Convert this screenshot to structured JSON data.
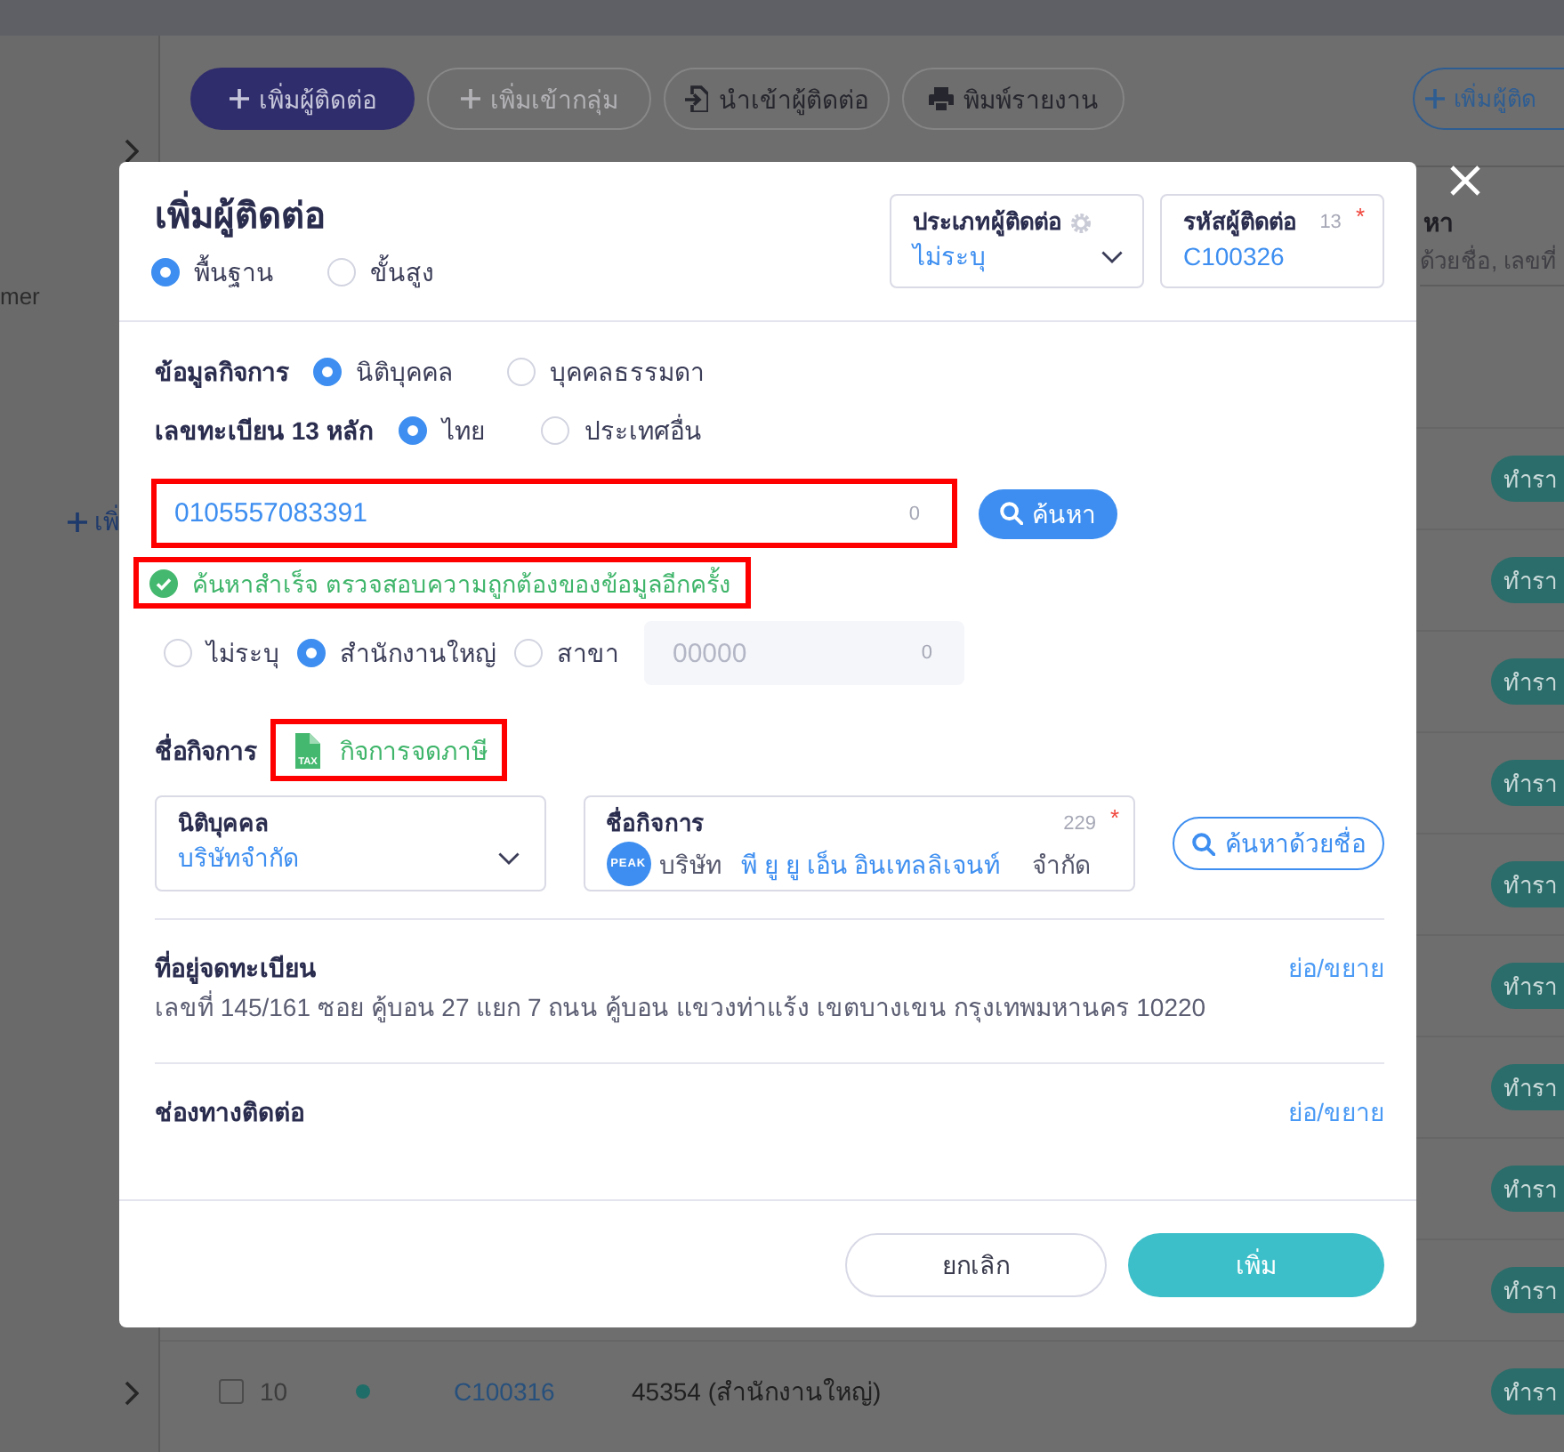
{
  "background": {
    "sidebar": {
      "item_text": "mer",
      "add_link": "เพิ่"
    },
    "toolbar": {
      "buttons": [
        {
          "label": "เพิ่มผู้ติดต่อ",
          "kind": "primary",
          "disabled": false
        },
        {
          "label": "เพิ่มเข้ากลุ่ม",
          "kind": "add",
          "disabled": true
        },
        {
          "label": "นำเข้าผู้ติดต่อ",
          "kind": "import",
          "disabled": false
        },
        {
          "label": "พิมพ์รายงาน",
          "kind": "print",
          "disabled": false
        }
      ],
      "right_button": "เพิ่มผู้ติด"
    },
    "search": {
      "label": "หา",
      "placeholder": "ด้วยชื่อ, เลขที่"
    },
    "table": {
      "rows": [
        {
          "action": "ทำรา"
        },
        {
          "action": "ทำรา"
        },
        {
          "action": "ทำรา"
        },
        {
          "action": "ทำรา"
        },
        {
          "action": "ทำรา"
        },
        {
          "action": "ทำรา"
        },
        {
          "action": "ทำรา"
        },
        {
          "action": "ทำรา"
        },
        {
          "action": "ทำรา"
        },
        {
          "checked": false,
          "number": "10",
          "code": "C100316",
          "name": "45354 (สำนักงานใหญ่)",
          "action": "ทำรา"
        }
      ]
    }
  },
  "modal": {
    "title": "เพิ่มผู้ติดต่อ",
    "modes": [
      {
        "label": "พื้นฐาน",
        "selected": true
      },
      {
        "label": "ขั้นสูง",
        "selected": false
      }
    ],
    "contact_type": {
      "label": "ประเภทผู้ติดต่อ",
      "value": "ไม่ระบุ"
    },
    "contact_code": {
      "label": "รหัสผู้ติดต่อ",
      "counter": "13",
      "required_mark": "*",
      "value": "C100326"
    },
    "business_info": {
      "label": "ข้อมูลกิจการ",
      "options": [
        {
          "label": "นิติบุคคล",
          "selected": true
        },
        {
          "label": "บุคคลธรรมดา",
          "selected": false
        }
      ]
    },
    "registration": {
      "label": "เลขทะเบียน 13 หลัก",
      "options": [
        {
          "label": "ไทย",
          "selected": true
        },
        {
          "label": "ประเทศอื่น",
          "selected": false
        }
      ],
      "value": "0105557083391",
      "counter": "0",
      "highlighted": true,
      "search_button": "ค้นหา"
    },
    "success_message": {
      "text": "ค้นหาสำเร็จ ตรวจสอบความถูกต้องของข้อมูลอีกครั้ง",
      "highlighted": true
    },
    "branch": {
      "options": [
        {
          "label": "ไม่ระบุ",
          "selected": false
        },
        {
          "label": "สำนักงานใหญ่",
          "selected": true
        },
        {
          "label": "สาขา",
          "selected": false
        }
      ],
      "placeholder": "00000",
      "counter": "0",
      "disabled": true
    },
    "business_name": {
      "label": "ชื่อกิจการ",
      "tax_badge": {
        "icon_text": "TAX",
        "text": "กิจการจดภาษี",
        "highlighted": true
      },
      "entity_type": {
        "label": "นิติบุคคล",
        "value": "บริษัทจำกัด"
      },
      "name_field": {
        "label": "ชื่อกิจการ",
        "counter": "229",
        "required_mark": "*",
        "logo_text": "PEAK",
        "prefix": "บริษัท",
        "value": "พี ยู ยู เอ็น อินเทลลิเจนท์",
        "suffix": "จำกัด"
      },
      "search_button": "ค้นหาด้วยชื่อ"
    },
    "sections": [
      {
        "title": "ที่อยู่จดทะเบียน",
        "toggle": "ย่อ/ขยาย",
        "text": "เลขที่ 145/161 ซอย คู้บอน 27 แยก 7 ถนน คู้บอน แขวงท่าแร้ง เขตบางเขน กรุงเทพมหานคร 10220"
      },
      {
        "title": "ช่องทางติดต่อ",
        "toggle": "ย่อ/ขยาย"
      }
    ],
    "buttons": [
      {
        "label": "ยกเลิก",
        "kind": "secondary"
      },
      {
        "label": "เพิ่ม",
        "kind": "primary"
      }
    ]
  }
}
